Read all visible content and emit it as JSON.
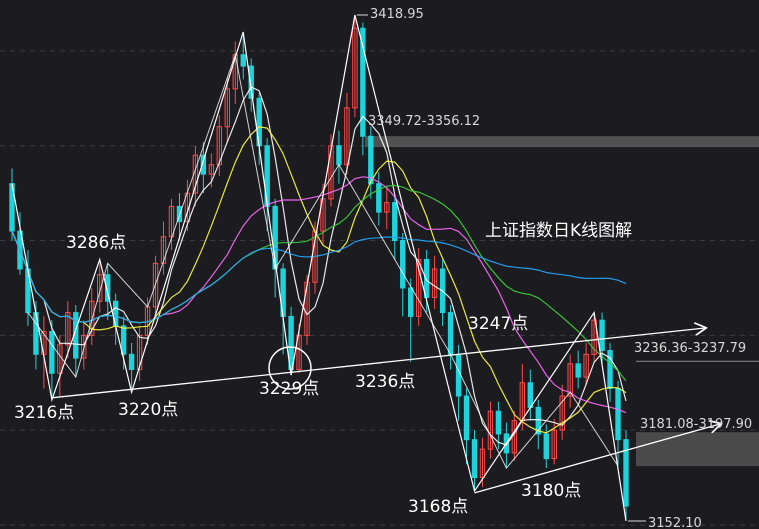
{
  "chart_data": {
    "type": "candlestick",
    "title": "上证指数日K线图解",
    "ylim": [
      3140,
      3440
    ],
    "candles": [
      [
        3330,
        3305,
        3338,
        3300
      ],
      [
        3305,
        3285,
        3315,
        3282
      ],
      [
        3285,
        3262,
        3295,
        3255
      ],
      [
        3262,
        3240,
        3268,
        3232
      ],
      [
        3240,
        3252,
        3260,
        3222
      ],
      [
        3252,
        3230,
        3258,
        3216
      ],
      [
        3230,
        3245,
        3250,
        3218
      ],
      [
        3245,
        3262,
        3268,
        3238
      ],
      [
        3262,
        3238,
        3266,
        3228
      ],
      [
        3238,
        3250,
        3258,
        3232
      ],
      [
        3250,
        3268,
        3275,
        3245
      ],
      [
        3268,
        3282,
        3290,
        3262
      ],
      [
        3282,
        3268,
        3288,
        3258
      ],
      [
        3268,
        3255,
        3272,
        3245
      ],
      [
        3255,
        3240,
        3260,
        3232
      ],
      [
        3240,
        3232,
        3246,
        3220
      ],
      [
        3232,
        3250,
        3255,
        3226
      ],
      [
        3250,
        3265,
        3270,
        3245
      ],
      [
        3265,
        3288,
        3292,
        3260
      ],
      [
        3288,
        3302,
        3310,
        3282
      ],
      [
        3302,
        3318,
        3322,
        3295
      ],
      [
        3318,
        3310,
        3325,
        3300
      ],
      [
        3310,
        3325,
        3332,
        3305
      ],
      [
        3325,
        3345,
        3350,
        3318
      ],
      [
        3345,
        3335,
        3352,
        3325
      ],
      [
        3335,
        3340,
        3346,
        3328
      ],
      [
        3340,
        3360,
        3366,
        3334
      ],
      [
        3360,
        3380,
        3386,
        3352
      ],
      [
        3380,
        3398,
        3405,
        3372
      ],
      [
        3398,
        3392,
        3410,
        3385
      ],
      [
        3392,
        3375,
        3396,
        3368
      ],
      [
        3375,
        3350,
        3378,
        3340
      ],
      [
        3350,
        3318,
        3354,
        3305
      ],
      [
        3318,
        3285,
        3322,
        3270
      ],
      [
        3285,
        3260,
        3288,
        3240
      ],
      [
        3260,
        3232,
        3265,
        3229
      ],
      [
        3232,
        3250,
        3256,
        3230
      ],
      [
        3250,
        3278,
        3282,
        3245
      ],
      [
        3278,
        3305,
        3310,
        3272
      ],
      [
        3305,
        3322,
        3330,
        3298
      ],
      [
        3322,
        3350,
        3356,
        3318
      ],
      [
        3350,
        3340,
        3358,
        3330
      ],
      [
        3340,
        3370,
        3378,
        3335
      ],
      [
        3370,
        3412,
        3418.95,
        3365
      ],
      [
        3412,
        3355,
        3415,
        3345
      ],
      [
        3355,
        3330,
        3360,
        3322
      ],
      [
        3330,
        3315,
        3336,
        3308
      ],
      [
        3315,
        3320,
        3328,
        3306
      ],
      [
        3320,
        3300,
        3324,
        3290
      ],
      [
        3300,
        3275,
        3304,
        3260
      ],
      [
        3275,
        3260,
        3280,
        3236
      ],
      [
        3260,
        3290,
        3296,
        3255
      ],
      [
        3290,
        3270,
        3295,
        3262
      ],
      [
        3270,
        3285,
        3292,
        3264
      ],
      [
        3285,
        3262,
        3290,
        3255
      ],
      [
        3262,
        3240,
        3266,
        3232
      ],
      [
        3240,
        3218,
        3245,
        3205
      ],
      [
        3218,
        3195,
        3222,
        3182
      ],
      [
        3195,
        3175,
        3200,
        3168
      ],
      [
        3175,
        3190,
        3196,
        3170
      ],
      [
        3190,
        3210,
        3215,
        3185
      ],
      [
        3210,
        3198,
        3215,
        3190
      ],
      [
        3198,
        3188,
        3204,
        3180
      ],
      [
        3188,
        3205,
        3210,
        3184
      ],
      [
        3205,
        3225,
        3235,
        3200
      ],
      [
        3225,
        3212,
        3232,
        3205
      ],
      [
        3212,
        3198,
        3216,
        3190
      ],
      [
        3198,
        3185,
        3203,
        3180
      ],
      [
        3185,
        3200,
        3206,
        3182
      ],
      [
        3200,
        3218,
        3224,
        3195
      ],
      [
        3218,
        3235,
        3240,
        3212
      ],
      [
        3235,
        3228,
        3242,
        3222
      ],
      [
        3228,
        3240,
        3246,
        3224
      ],
      [
        3240,
        3258,
        3262,
        3236
      ],
      [
        3258,
        3242,
        3262,
        3235
      ],
      [
        3242,
        3222,
        3246,
        3215
      ],
      [
        3222,
        3195,
        3226,
        3181.08
      ],
      [
        3195,
        3160,
        3200,
        3152.1
      ]
    ],
    "annotations": {
      "peak_labels": [
        {
          "text": "3286点",
          "value": 3286
        },
        {
          "text": "3216点",
          "value": 3216
        },
        {
          "text": "3220点",
          "value": 3220
        },
        {
          "text": "3229点",
          "value": 3229
        },
        {
          "text": "3236点",
          "value": 3236
        },
        {
          "text": "3247点",
          "value": 3247
        },
        {
          "text": "3168点",
          "value": 3168
        },
        {
          "text": "3180点",
          "value": 3180
        }
      ],
      "price_marks": [
        {
          "text": "3418.95",
          "value": 3418.95
        },
        {
          "text": "3349.72-3356.12",
          "low": 3349.72,
          "high": 3356.12
        },
        {
          "text": "3236.36-3237.79",
          "low": 3236.36,
          "high": 3237.79
        },
        {
          "text": "3181.08-3197.90",
          "low": 3181.08,
          "high": 3197.9
        },
        {
          "text": "3152.10",
          "value": 3152.1
        }
      ]
    },
    "colors": {
      "up": "#ff4a4a",
      "down": "#1fd3db",
      "ma5": "#ffffff",
      "ma10": "#ffff3c",
      "ma20": "#ff6cff",
      "ma30": "#3bd23b",
      "ma60": "#23a8ff",
      "zone": "#5a5a5a",
      "grid": "#3a3a40"
    }
  }
}
